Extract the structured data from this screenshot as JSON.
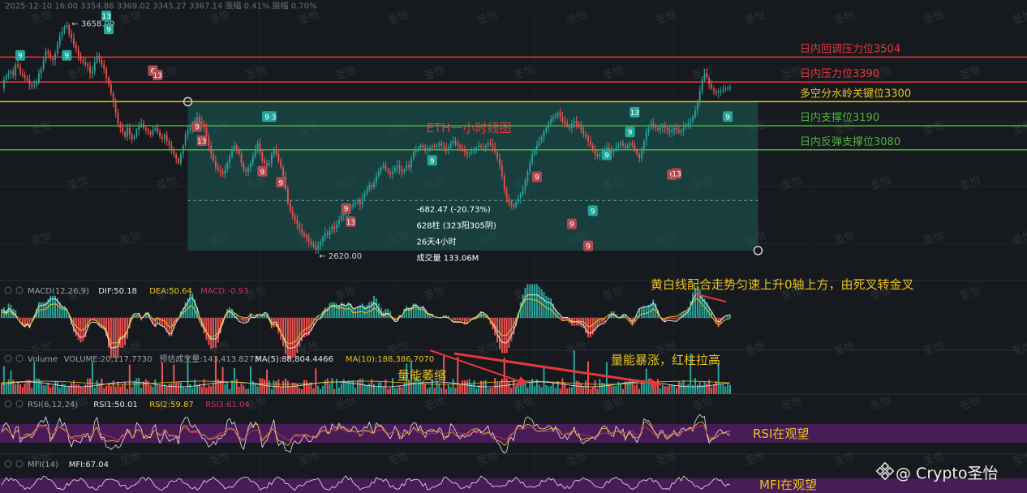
{
  "header_readout": "2025-12-10 16:00  3354.86  3369.02  3345.27  3367.14  涨幅 0.41%  振幅 0.70%",
  "watermark": "圣怡",
  "brand": {
    "name": "Crypto圣怡",
    "icon": "binance-square-icon"
  },
  "chart_data": [
    {
      "type": "line",
      "pane": "price",
      "title": "ETH一小时线图",
      "y_unit": "USDT",
      "ylim": [
        2520,
        3720
      ],
      "x_count": 330,
      "price_series_close": [
        3360,
        3400,
        3420,
        3430,
        3440,
        3420,
        3470,
        3460,
        3430,
        3420,
        3410,
        3400,
        3380,
        3370,
        3375,
        3390,
        3430,
        3450,
        3490,
        3530,
        3520,
        3500,
        3490,
        3520,
        3560,
        3600,
        3620,
        3640,
        3650,
        3610,
        3590,
        3560,
        3540,
        3510,
        3490,
        3480,
        3470,
        3460,
        3430,
        3440,
        3480,
        3510,
        3490,
        3470,
        3450,
        3410,
        3380,
        3340,
        3300,
        3250,
        3200,
        3180,
        3160,
        3140,
        3180,
        3150,
        3130,
        3140,
        3170,
        3190,
        3200,
        3180,
        3170,
        3160,
        3150,
        3170,
        3180,
        3160,
        3140,
        3130,
        3150,
        3120,
        3100,
        3080,
        3060,
        3040,
        3020,
        3060,
        3100,
        3150,
        3170,
        3180,
        3200,
        3210,
        3230,
        3210,
        3200,
        3180,
        3140,
        3100,
        3060,
        3030,
        3000,
        2990,
        2980,
        2970,
        2990,
        3020,
        3050,
        3080,
        3100,
        3080,
        3060,
        3020,
        2990,
        2980,
        3000,
        3020,
        3050,
        3080,
        3110,
        3070,
        3030,
        3020,
        3010,
        3020,
        3060,
        3080,
        3060,
        3030,
        3000,
        2960,
        2900,
        2840,
        2800,
        2780,
        2760,
        2740,
        2720,
        2700,
        2690,
        2680,
        2660,
        2650,
        2640,
        2625,
        2640,
        2660,
        2680,
        2700,
        2690,
        2710,
        2730,
        2720,
        2740,
        2760,
        2780,
        2790,
        2800,
        2810,
        2820,
        2830,
        2840,
        2850,
        2830,
        2860,
        2880,
        2900,
        2920,
        2910,
        2930,
        2960,
        2980,
        3000,
        3010,
        2990,
        2980,
        2970,
        2980,
        3000,
        3010,
        2990,
        2980,
        2990,
        3010,
        3000,
        3040,
        3070,
        3080,
        3090,
        3100,
        3090,
        3080,
        3085,
        3090,
        3100,
        3095,
        3100,
        3110,
        3100,
        3090,
        3080,
        3090,
        3110,
        3120,
        3110,
        3100,
        3090,
        3080,
        3070,
        3060,
        3065,
        3070,
        3080,
        3090,
        3100,
        3095,
        3090,
        3100,
        3110,
        3105,
        3090,
        3070,
        3040,
        3010,
        2960,
        2900,
        2860,
        2840,
        2830,
        2820,
        2840,
        2860,
        2880,
        2900,
        2940,
        2980,
        3020,
        3060,
        3080,
        3100,
        3120,
        3140,
        3160,
        3180,
        3200,
        3220,
        3230,
        3240,
        3250,
        3230,
        3210,
        3200,
        3190,
        3180,
        3200,
        3210,
        3200,
        3190,
        3170,
        3150,
        3140,
        3120,
        3100,
        3080,
        3060,
        3050,
        3060,
        3070,
        3080,
        3090,
        3080,
        3070,
        3080,
        3090,
        3100,
        3110,
        3100,
        3090,
        3100,
        3110,
        3100,
        3080,
        3060,
        3040,
        3080,
        3120,
        3160,
        3180,
        3200,
        3190,
        3180,
        3170,
        3180,
        3190,
        3180,
        3170,
        3160,
        3170,
        3180,
        3170,
        3160,
        3170,
        3180,
        3190,
        3200,
        3210,
        3230,
        3260,
        3300,
        3350,
        3400,
        3430,
        3410,
        3380,
        3360,
        3350,
        3340,
        3345,
        3350,
        3355,
        3360,
        3362,
        3365
      ],
      "high_label": "3658.00",
      "low_label": "2620.00",
      "horizontal_levels": [
        {
          "label": "日内回调压力位3504",
          "value": 3504,
          "color": "#e5373d"
        },
        {
          "label": "日内压力位3390",
          "value": 3390,
          "color": "#e5373d"
        },
        {
          "label": "多空分水岭关键位3300",
          "value": 3300,
          "color": "#e8c21c"
        },
        {
          "label": "日内支撑位3190",
          "value": 3190,
          "color": "#4fb53a"
        },
        {
          "label": "日内反弹支撑位3080",
          "value": 3080,
          "color": "#4fb53a"
        }
      ],
      "td_markers": [
        {
          "x": 8,
          "label": "9",
          "kind": "sell",
          "value": 3510
        },
        {
          "x": 28,
          "label": "9",
          "kind": "sell",
          "value": 3510
        },
        {
          "x": 45,
          "label": "13",
          "kind": "sell",
          "value": 3690
        },
        {
          "x": 46,
          "label": "9",
          "kind": "sell",
          "value": 3630
        },
        {
          "x": 65,
          "label": "6",
          "kind": "buy",
          "value": 3440
        },
        {
          "x": 67,
          "label": "13",
          "kind": "buy",
          "value": 3420
        },
        {
          "x": 84,
          "label": "9",
          "kind": "buy",
          "value": 3185
        },
        {
          "x": 86,
          "label": "13",
          "kind": "buy",
          "value": 3120
        },
        {
          "x": 112,
          "label": "9",
          "kind": "buy",
          "value": 2980
        },
        {
          "x": 116,
          "label": "13",
          "kind": "sell",
          "value": 3230
        },
        {
          "x": 114,
          "label": "9",
          "kind": "sell",
          "value": 3230
        },
        {
          "x": 120,
          "label": "9",
          "kind": "buy",
          "value": 2930
        },
        {
          "x": 148,
          "label": "9",
          "kind": "buy",
          "value": 2810
        },
        {
          "x": 150,
          "label": "13",
          "kind": "buy",
          "value": 2750
        },
        {
          "x": 185,
          "label": "9",
          "kind": "sell",
          "value": 3030
        },
        {
          "x": 230,
          "label": "9",
          "kind": "buy",
          "value": 2955
        },
        {
          "x": 245,
          "label": "9",
          "kind": "buy",
          "value": 2740
        },
        {
          "x": 252,
          "label": "9",
          "kind": "buy",
          "value": 2640
        },
        {
          "x": 254,
          "label": "9",
          "kind": "sell",
          "value": 2800
        },
        {
          "x": 260,
          "label": "9",
          "kind": "sell",
          "value": 3055
        },
        {
          "x": 270,
          "label": "9",
          "kind": "sell",
          "value": 3160
        },
        {
          "x": 272,
          "label": "13",
          "kind": "sell",
          "value": 3250
        },
        {
          "x": 288,
          "label": "9",
          "kind": "buy",
          "value": 2965
        },
        {
          "x": 290,
          "label": "13",
          "kind": "buy",
          "value": 2970
        },
        {
          "x": 312,
          "label": "9",
          "kind": "sell",
          "value": 3230
        }
      ],
      "measure_box": {
        "x_start": 80,
        "x_end": 325,
        "y_top": 3300,
        "y_bottom": 2620,
        "lines": [
          "-682.47 (-20.73%)",
          "628柱 (323阳305阴)",
          "26天4小时",
          "成交量 133.06M"
        ]
      }
    },
    {
      "type": "bar",
      "pane": "macd",
      "header": [
        "MACD(12,26,9)",
        "DIF:50.18",
        "DEA:50.64",
        "MACD:-0.93"
      ],
      "header_colors": [
        "#9aa0a6",
        "#e8e8e8",
        "#e8c21c",
        "#d0306c"
      ],
      "annotation": "黄白线配合走势匀速上升0轴上方，由死叉转金叉"
    },
    {
      "type": "bar",
      "pane": "volume",
      "header": [
        "Volume",
        "VOLUME:20,117.7730",
        "预估成交量:143,413.8273",
        "MA(5):88,804.4466",
        "MA(10):188,386.7070"
      ],
      "header_colors": [
        "#9aa0a6",
        "#9aa0a6",
        "#9aa0a6",
        "#e8e8e8",
        "#e8c21c"
      ],
      "annotations": [
        "量能萎缩",
        "量能暴涨，红柱拉高"
      ]
    },
    {
      "type": "line",
      "pane": "rsi",
      "header": [
        "RSI(6,12,24)",
        "RSI1:50.01",
        "RSI2:59.87",
        "RSI3:61.04"
      ],
      "header_colors": [
        "#9aa0a6",
        "#e8e8e8",
        "#e8c21c",
        "#d0306c"
      ],
      "annotation": "RSI在观望"
    },
    {
      "type": "line",
      "pane": "mfi",
      "header": [
        "MFI(14)",
        "MFI:67.04"
      ],
      "header_colors": [
        "#9aa0a6",
        "#e8e8e8"
      ],
      "annotation": "MFI在观望"
    }
  ]
}
